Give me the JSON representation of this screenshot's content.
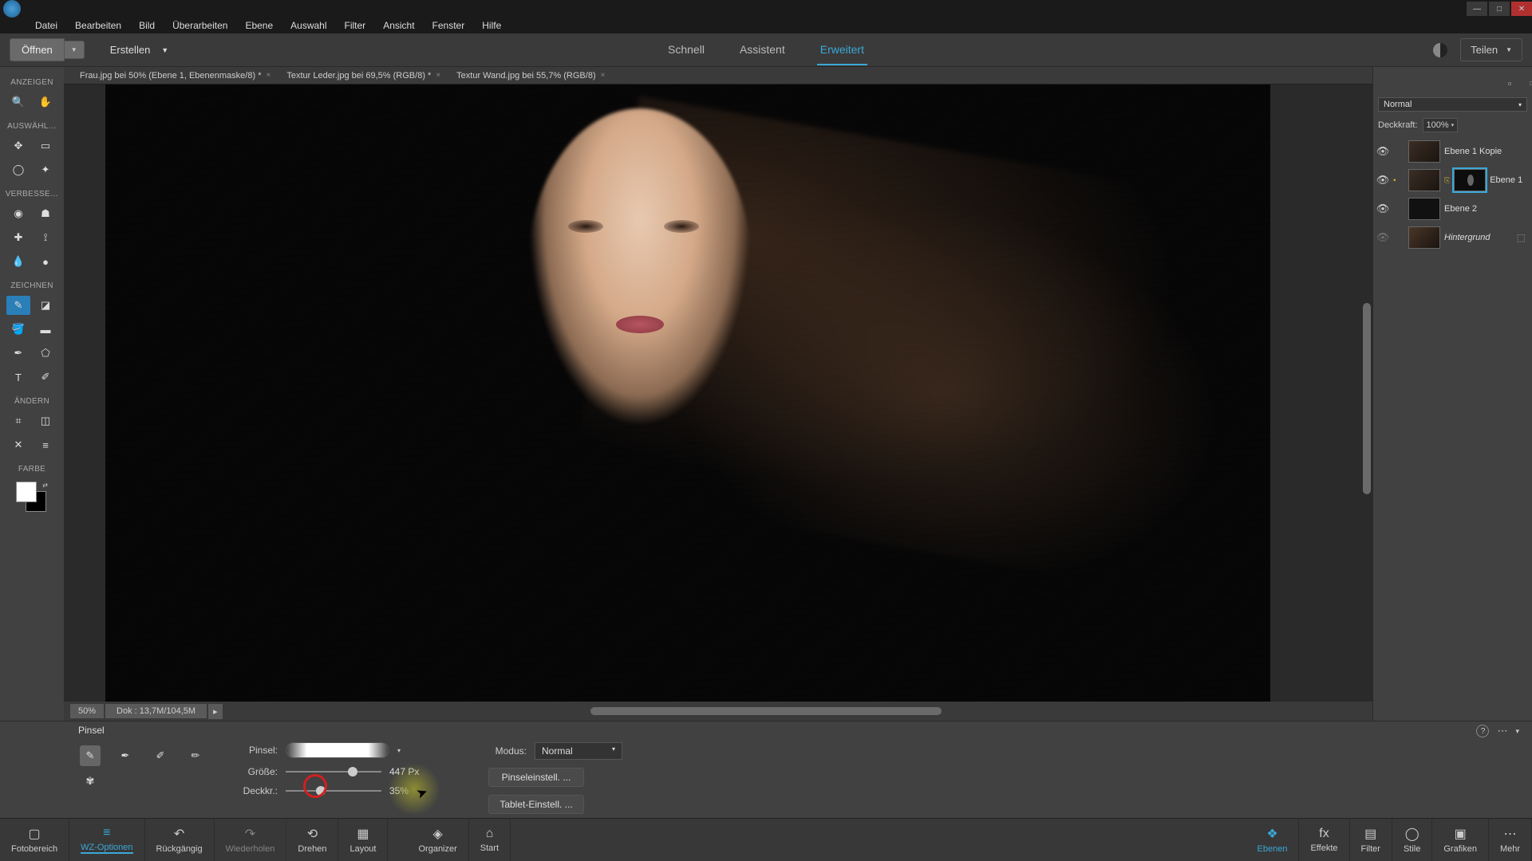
{
  "menubar": [
    "Datei",
    "Bearbeiten",
    "Bild",
    "Überarbeiten",
    "Ebene",
    "Auswahl",
    "Filter",
    "Ansicht",
    "Fenster",
    "Hilfe"
  ],
  "topbar": {
    "open": "Öffnen",
    "create": "Erstellen",
    "modes": {
      "quick": "Schnell",
      "guided": "Assistent",
      "expert": "Erweitert"
    },
    "share": "Teilen"
  },
  "doctabs": [
    "Frau.jpg bei 50% (Ebene 1, Ebenenmaske/8) *",
    "Textur Leder.jpg bei 69,5% (RGB/8) *",
    "Textur Wand.jpg bei 55,7% (RGB/8)"
  ],
  "toolgroups": {
    "view": "ANZEIGEN",
    "select": "AUSWÄHL…",
    "enhance": "VERBESSE…",
    "draw": "ZEICHNEN",
    "modify": "ÄNDERN",
    "color": "FARBE"
  },
  "canvas_status": {
    "zoom": "50%",
    "dok": "Dok : 13,7M/104,5M"
  },
  "layers": {
    "blend_label": "Normal",
    "deckk_label": "Deckkraft:",
    "deckk_val": "100%",
    "rows": [
      {
        "name": "Ebene 1 Kopie"
      },
      {
        "name": "Ebene 1"
      },
      {
        "name": "Ebene 2"
      },
      {
        "name": "Hintergrund"
      }
    ]
  },
  "tooloptions": {
    "title": "Pinsel",
    "pinsel_label": "Pinsel:",
    "groesse_label": "Größe:",
    "groesse_val": "447 Px",
    "deckkr_label": "Deckkr.:",
    "deckkr_val": "35%",
    "modus_label": "Modus:",
    "modus_val": "Normal",
    "btn1": "Pinseleinstell. ...",
    "btn2": "Tablet-Einstell. ..."
  },
  "bottombar": {
    "left": [
      {
        "k": "fotobereich",
        "label": "Fotobereich",
        "icon": "▢"
      },
      {
        "k": "wzopt",
        "label": "WZ-Optionen",
        "icon": "≡"
      },
      {
        "k": "undo",
        "label": "Rückgängig",
        "icon": "↶"
      },
      {
        "k": "redo",
        "label": "Wiederholen",
        "icon": "↷"
      },
      {
        "k": "drehen",
        "label": "Drehen",
        "icon": "⟲"
      },
      {
        "k": "layout",
        "label": "Layout",
        "icon": "▦"
      }
    ],
    "center": [
      {
        "k": "organizer",
        "label": "Organizer",
        "icon": "◈"
      },
      {
        "k": "start",
        "label": "Start",
        "icon": "⌂"
      }
    ],
    "right": [
      {
        "k": "ebenen",
        "label": "Ebenen",
        "icon": "❖"
      },
      {
        "k": "effekte",
        "label": "Effekte",
        "icon": "fx"
      },
      {
        "k": "filter",
        "label": "Filter",
        "icon": "▤"
      },
      {
        "k": "stile",
        "label": "Stile",
        "icon": "◯"
      },
      {
        "k": "grafiken",
        "label": "Grafiken",
        "icon": "▣"
      },
      {
        "k": "mehr",
        "label": "Mehr",
        "icon": "⋯"
      }
    ]
  }
}
